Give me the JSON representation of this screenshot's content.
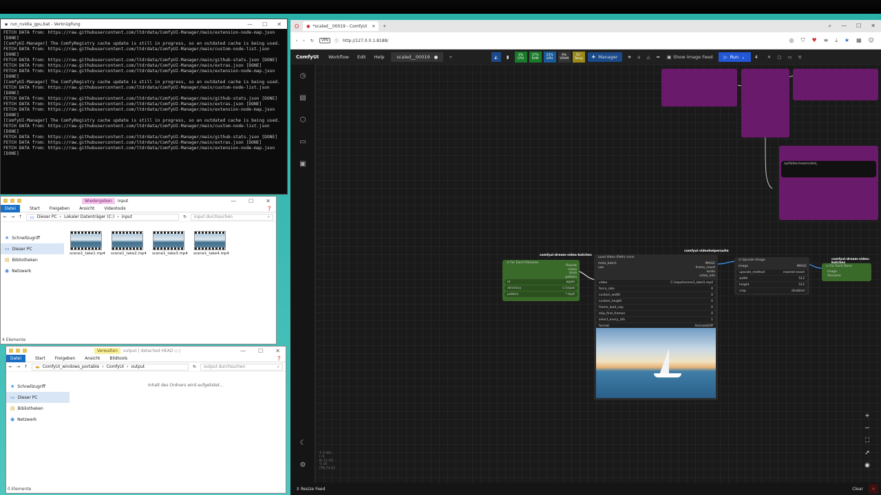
{
  "console": {
    "title": "run_nvidia_gpu.bat - Verknüpfung",
    "lines": [
      "FETCH DATA from: https://raw.githubusercontent.com/ltdrdata/ComfyUI-Manager/main/extension-node-map.json [DONE]",
      "[ComfyUI-Manager] The ComfyRegistry cache update is still in progress, so an outdated cache is being used.",
      "FETCH DATA from: https://raw.githubusercontent.com/ltdrdata/ComfyUI-Manager/main/custom-node-list.json [DONE]",
      "FETCH DATA from: https://raw.githubusercontent.com/ltdrdata/ComfyUI-Manager/main/github-stats.json [DONE]",
      "FETCH DATA from: https://raw.githubusercontent.com/ltdrdata/ComfyUI-Manager/main/extras.json [DONE]",
      "FETCH DATA from: https://raw.githubusercontent.com/ltdrdata/ComfyUI-Manager/main/extension-node-map.json [DONE]",
      "[ComfyUI-Manager] The ComfyRegistry cache update is still in progress, so an outdated cache is being used.",
      "FETCH DATA from: https://raw.githubusercontent.com/ltdrdata/ComfyUI-Manager/main/custom-node-list.json [DONE]",
      "FETCH DATA from: https://raw.githubusercontent.com/ltdrdata/ComfyUI-Manager/main/github-stats.json [DONE]",
      "FETCH DATA from: https://raw.githubusercontent.com/ltdrdata/ComfyUI-Manager/main/extras.json [DONE]",
      "FETCH DATA from: https://raw.githubusercontent.com/ltdrdata/ComfyUI-Manager/main/extension-node-map.json [DONE]",
      "[ComfyUI-Manager] The ComfyRegistry cache update is still in progress, so an outdated cache is being used.",
      "FETCH DATA from: https://raw.githubusercontent.com/ltdrdata/ComfyUI-Manager/main/custom-node-list.json [DONE]",
      "FETCH DATA from: https://raw.githubusercontent.com/ltdrdata/ComfyUI-Manager/main/github-stats.json [DONE]",
      "FETCH DATA from: https://raw.githubusercontent.com/ltdrdata/ComfyUI-Manager/main/extras.json [DONE]",
      "FETCH DATA from: https://raw.githubusercontent.com/ltdrdata/ComfyUI-Manager/main/extension-node-map.json [DONE]"
    ]
  },
  "explorer_input": {
    "context_tab": "Wiedergeben",
    "title": "input",
    "ribbon": [
      "Datei",
      "Start",
      "Freigeben",
      "Ansicht",
      "Videotools"
    ],
    "path": [
      "Dieser PC",
      "Lokaler Datenträger (C:)",
      "input"
    ],
    "search_placeholder": "input durchsuchen",
    "nav": [
      "Schnellzugriff",
      "Dieser PC",
      "Bibliotheken",
      "Netzwerk"
    ],
    "files": [
      "scene1_take1.mp4",
      "scene1_take2.mp4",
      "scene1_take3.mp4",
      "scene1_take4.mp4"
    ],
    "status": "4 Elemente"
  },
  "explorer_output": {
    "context_tab": "Verwalten",
    "title": "output | detached HEAD ◇ |",
    "ribbon": [
      "Datei",
      "Start",
      "Freigeben",
      "Ansicht",
      "Bildtools"
    ],
    "path": [
      "ComfyUI_windows_portable",
      "ComfyUI",
      "output"
    ],
    "search_placeholder": "output durchsuchen",
    "nav": [
      "Schnellzugriff",
      "Dieser PC",
      "Bibliotheken",
      "Netzwerk"
    ],
    "empty": "Inhalt des Ordners wird aufgelistet...",
    "status": "0 Elemente"
  },
  "browser": {
    "tab_title": "*scaled__00019 - ComfyUI",
    "url": "http://127.0.0.1:8188/",
    "vpn": "VPN"
  },
  "comfy": {
    "logo": "ComfyUI",
    "menu": [
      "Workflow",
      "Edit",
      "Help"
    ],
    "workflow_tab": "scaled__00019",
    "stats": [
      {
        "label": "CPU",
        "value": "4%",
        "color": "#1a7a2a"
      },
      {
        "label": "RAM",
        "value": "37%",
        "color": "#1a7a2a"
      },
      {
        "label": "GPU",
        "value": "22%",
        "color": "#1a5a9a"
      },
      {
        "label": "VRAM",
        "value": "9%",
        "color": "#333333"
      },
      {
        "label": "Temp",
        "value": "51°",
        "color": "#9a8a1a"
      }
    ],
    "manager": "Manager",
    "image_feed": "Show Image Feed",
    "run": "Run",
    "queue_count": "4",
    "info": [
      "T: 0.00s",
      "I: 0",
      "N: 11 [0]",
      "V: 26",
      "FPS:74.63"
    ],
    "resize_feed": "Resize Feed",
    "clear": "Clear"
  },
  "nodes": {
    "for_each_filename": {
      "group": "comfyui-dream-video-batches",
      "title": "⊙ For Each Filename",
      "outputs": [
        "Repeat",
        "name",
        "stem",
        "pattern"
      ],
      "rows": [
        [
          "id",
          "apple"
        ],
        [
          "directory",
          "C:\\input"
        ],
        [
          "pattern",
          "*.mp4"
        ]
      ]
    },
    "load_video": {
      "group": "comfyui-videohelpersuite",
      "title": "Load Video (Path) ⊙⊙⊙",
      "inputs": [
        "meta_batch",
        "vae"
      ],
      "outputs": [
        "IMAGE",
        "frame_count",
        "audio",
        "video_info"
      ],
      "rows": [
        [
          "video",
          "C:\\input\\scene1_take1.mp4"
        ],
        [
          "force_rate",
          "0"
        ],
        [
          "custom_width",
          "0"
        ],
        [
          "custom_height",
          "0"
        ],
        [
          "frame_load_cap",
          "0"
        ],
        [
          "skip_first_frames",
          "0"
        ],
        [
          "select_every_nth",
          "1"
        ],
        [
          "format",
          "AnimateDiff"
        ]
      ]
    },
    "upscale_image": {
      "title": "⊙ Upscale Image",
      "inputs": [
        "image"
      ],
      "outputs": [
        "IMAGE"
      ],
      "rows": [
        [
          "upscale_method",
          "nearest-exact"
        ],
        [
          "width",
          "512"
        ],
        [
          "height",
          "512"
        ],
        [
          "crop",
          "disabled"
        ]
      ]
    },
    "for_each_done": {
      "group": "comfyui-dream-video-batches",
      "title": "⊙ For Each Done",
      "inputs": [
        "image",
        "filename"
      ]
    },
    "top_node_text": "ay/folder/new/scaled_"
  }
}
